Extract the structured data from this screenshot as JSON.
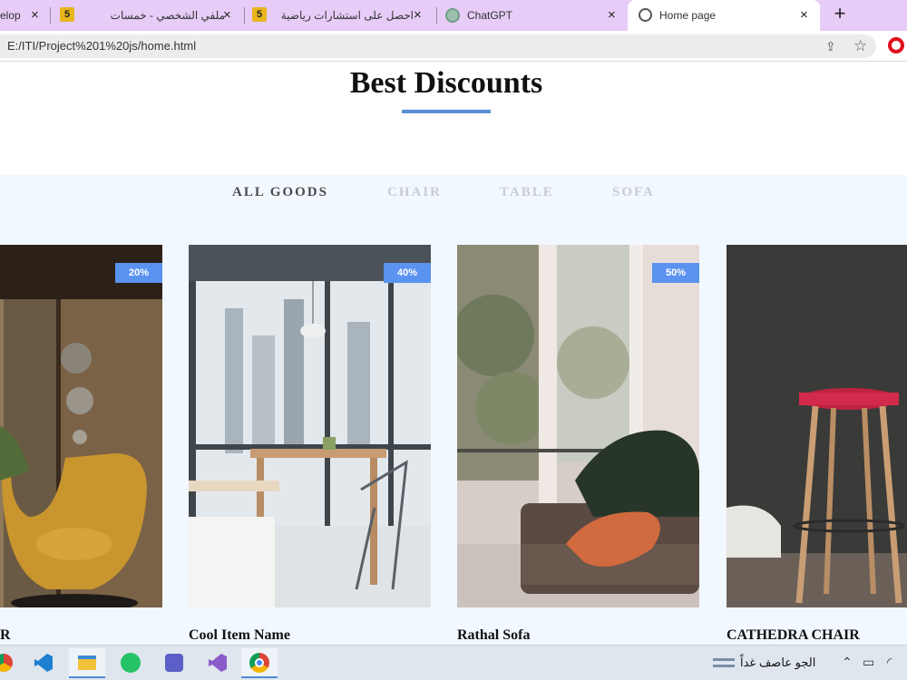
{
  "browser": {
    "tabs": [
      {
        "title": "elop"
      },
      {
        "title": "ملفي الشخصي - خمسات"
      },
      {
        "title": "احصل على استشارات رياضية"
      },
      {
        "title": "ChatGPT"
      },
      {
        "title": "Home page",
        "active": true
      }
    ],
    "favicon_5": "5",
    "close_glyph": "×",
    "new_tab_glyph": "+",
    "url": "E:/ITI/Project%201%20js/home.html"
  },
  "page": {
    "heading": "Best Discounts",
    "filters": [
      {
        "label": "ALL GOODS",
        "active": true
      },
      {
        "label": "CHAIR",
        "active": false
      },
      {
        "label": "TABLE",
        "active": false
      },
      {
        "label": "SOFA",
        "active": false
      }
    ],
    "products": [
      {
        "name": "EGG CHAIR",
        "name_visible": "R",
        "discount": "20%"
      },
      {
        "name": "Cool Item Name",
        "discount": "40%"
      },
      {
        "name": "Rathal Sofa",
        "discount": "50%"
      },
      {
        "name": "CATHEDRA CHAIR",
        "discount": ""
      }
    ],
    "accent_color": "#5b8fd6",
    "badge_color": "#5b93f0"
  },
  "taskbar": {
    "weather_text": "الجو عاصف غداً"
  }
}
